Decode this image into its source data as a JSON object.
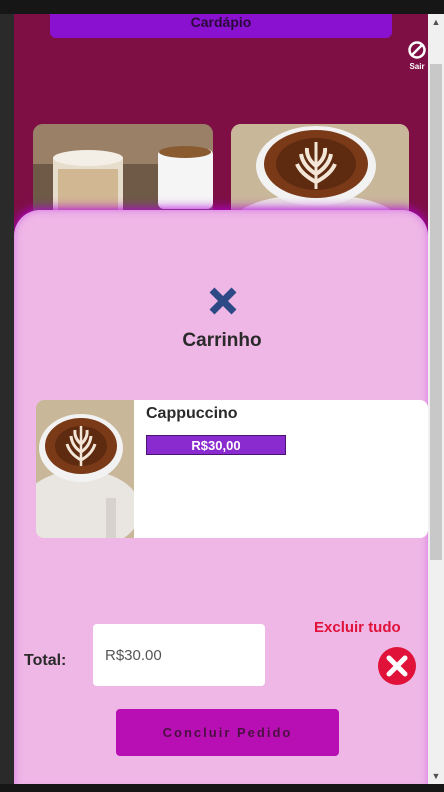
{
  "header": {
    "menu_title": "Cardápio"
  },
  "logout": {
    "label": "Sair",
    "icon": "block-icon"
  },
  "products": [
    {
      "name": "latte",
      "icon": "latte-photo"
    },
    {
      "name": "cappuccino",
      "icon": "cappuccino-photo"
    }
  ],
  "cart": {
    "title": "Carrinho",
    "close_icon": "close-icon",
    "items": [
      {
        "name": "Cappuccino",
        "price": "R$30,00"
      }
    ],
    "total_label": "Total:",
    "total_value": "R$30.00",
    "delete_all_label": "Excluir tudo",
    "checkout_label": "Concluir Pedido"
  },
  "colors": {
    "page_bg": "#7d0f45",
    "cart_bg": "#efb7e6",
    "accent_purple": "#8a11d0",
    "button_magenta": "#b80fb5",
    "danger": "#e0123a",
    "close_icon": "#2e4a86"
  }
}
